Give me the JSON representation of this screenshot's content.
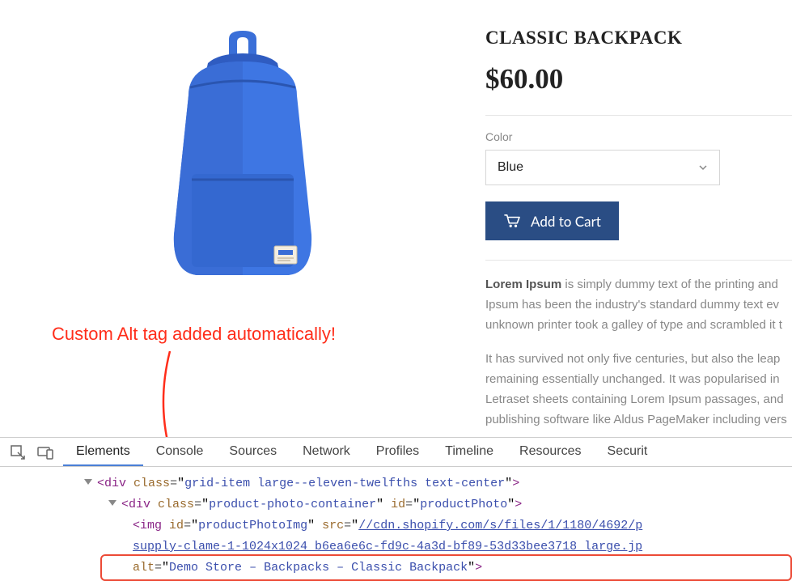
{
  "product": {
    "title": "CLASSIC BACKPACK",
    "price": "$60.00",
    "color_label": "Color",
    "color_value": "Blue",
    "add_to_cart": "Add to Cart",
    "desc1_strong": "Lorem Ipsum",
    "desc1_rest": " is simply dummy text of the printing and Ipsum has been the industry's standard dummy text ev unknown printer took a galley of type and scrambled it t",
    "desc2": "It has survived not only five centuries, but also the leap remaining essentially unchanged. It was popularised in Letraset sheets containing Lorem Ipsum passages, and publishing software like Aldus PageMaker including vers"
  },
  "annotation": {
    "text": "Custom Alt tag added automatically!"
  },
  "devtools": {
    "tabs": [
      "Elements",
      "Console",
      "Sources",
      "Network",
      "Profiles",
      "Timeline",
      "Resources",
      "Securit"
    ],
    "active_tab": 0
  },
  "code": {
    "div1_class": "grid-item large--eleven-twelfths text-center",
    "div2_class": "product-photo-container",
    "div2_id": "productPhoto",
    "img_id": "productPhotoImg",
    "src_prefix": "//cdn.shopify.com/s/files/1/1180/4692/p",
    "src_line2": "supply-clame-1-1024x1024_b6ea6e6c-fd9c-4a3d-bf89-53d33bee3718_large.jp",
    "alt_value": "Demo Store – Backpacks – Classic Backpack"
  }
}
